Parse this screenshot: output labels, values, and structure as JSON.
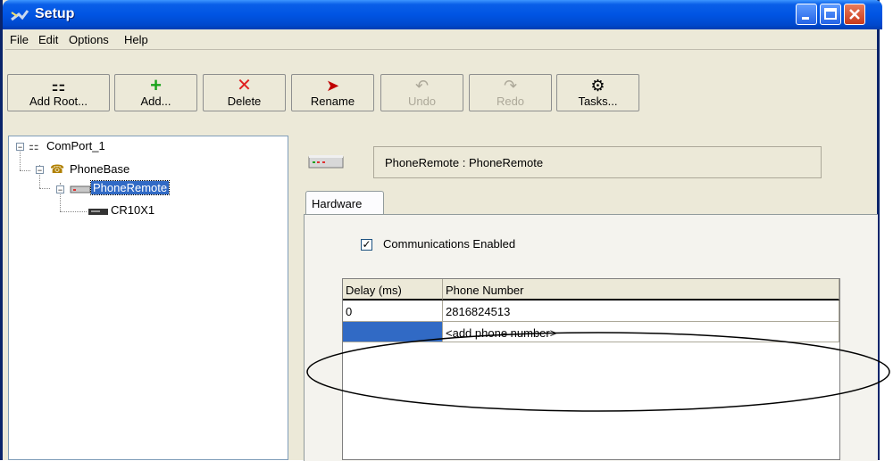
{
  "window": {
    "title": "Setup"
  },
  "menu": [
    "File",
    "Edit",
    "Options",
    "Help"
  ],
  "toolbar": [
    {
      "label": "Add Root...",
      "icon": "add-root-icon",
      "enabled": true
    },
    {
      "label": "Add...",
      "icon": "plus-icon",
      "enabled": true
    },
    {
      "label": "Delete",
      "icon": "x-icon",
      "enabled": true
    },
    {
      "label": "Rename",
      "icon": "rename-icon",
      "enabled": true
    },
    {
      "label": "Undo",
      "icon": "undo-icon",
      "enabled": false
    },
    {
      "label": "Redo",
      "icon": "redo-icon",
      "enabled": false
    },
    {
      "label": "Tasks...",
      "icon": "tasks-icon",
      "enabled": true
    }
  ],
  "tree": [
    {
      "label": "ComPort_1",
      "level": 0,
      "expander": "−",
      "icon": "comport-icon"
    },
    {
      "label": "PhoneBase",
      "level": 1,
      "expander": "−",
      "icon": "phonebase-icon"
    },
    {
      "label": "PhoneRemote",
      "level": 2,
      "expander": "−",
      "icon": "modem-icon",
      "selected": true
    },
    {
      "label": "CR10X1",
      "level": 3,
      "icon": "datalogger-icon"
    }
  ],
  "details": {
    "header": "PhoneRemote : PhoneRemote",
    "tab": "Hardware",
    "checkbox_label": "Communications Enabled",
    "checkbox_checked": true,
    "grid": {
      "columns": [
        "Delay (ms)",
        "Phone Number"
      ],
      "rows": [
        [
          "0",
          "2816824513"
        ],
        [
          "",
          "<add phone number>"
        ]
      ]
    }
  },
  "colors": {
    "title": "#0054e3",
    "selection": "#316ac5",
    "panel": "#ece9d8"
  }
}
